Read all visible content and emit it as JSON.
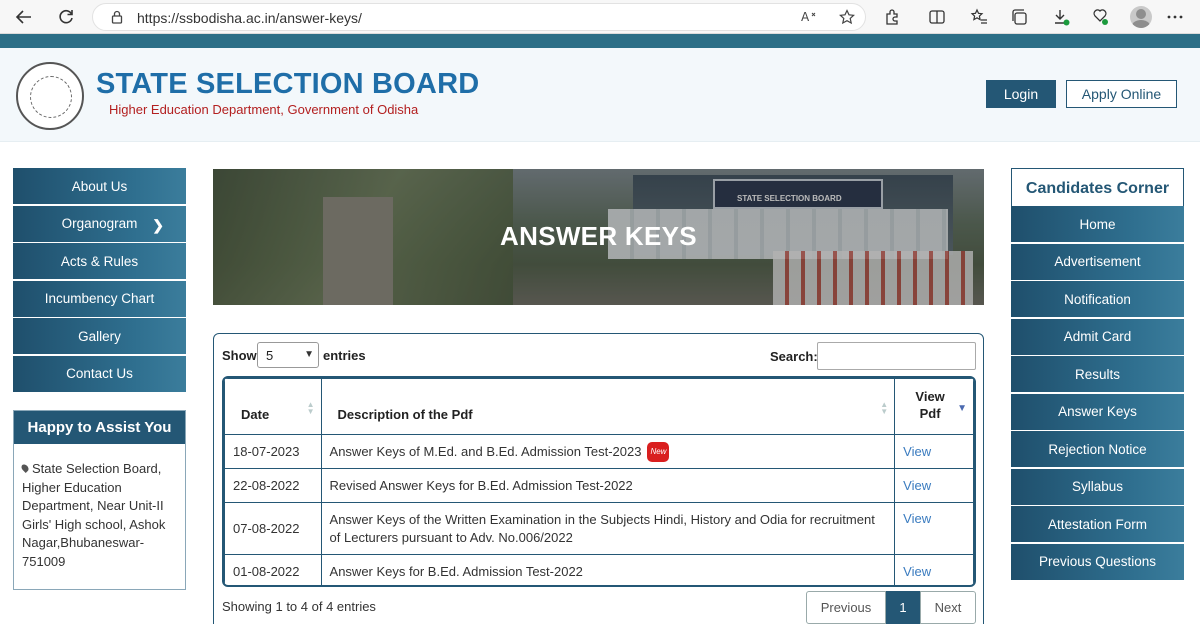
{
  "browser": {
    "url": "https://ssbodisha.ac.in/answer-keys/"
  },
  "header": {
    "title": "STATE SELECTION BOARD",
    "subtitle": "Higher Education Department, Government of Odisha",
    "login_label": "Login",
    "apply_label": "Apply Online"
  },
  "left_nav": {
    "items": [
      {
        "label": "About Us"
      },
      {
        "label": "Organogram",
        "has_submenu": true
      },
      {
        "label": "Acts & Rules"
      },
      {
        "label": "Incumbency Chart"
      },
      {
        "label": "Gallery"
      },
      {
        "label": "Contact Us"
      }
    ]
  },
  "assist": {
    "title": "Happy to Assist You",
    "address": "State Selection Board, Higher Education Department, Near Unit-II Girls' High school, Ashok Nagar,Bhubaneswar-751009"
  },
  "banner": {
    "title": "ANSWER KEYS",
    "sign_text": "STATE SELECTION BOARD"
  },
  "table": {
    "show_label": "Show",
    "entries_value": "5",
    "entries_label": "entries",
    "search_label": "Search:",
    "search_value": "",
    "columns": [
      "Date",
      "Description of the Pdf",
      "View Pdf"
    ],
    "rows": [
      {
        "date": "18-07-2023",
        "description": "Answer Keys of M.Ed. and B.Ed. Admission Test-2023",
        "badge": "New",
        "view": "View"
      },
      {
        "date": "22-08-2022",
        "description": "Revised Answer Keys for B.Ed. Admission Test-2022",
        "view": "View"
      },
      {
        "date": "07-08-2022",
        "description": "Answer Keys of the Written Examination in the Subjects Hindi, History and Odia for recruitment of Lecturers pursuant to Adv. No.006/2022",
        "view": "View"
      },
      {
        "date": "01-08-2022",
        "description": "Answer Keys for B.Ed. Admission Test-2022",
        "view": "View"
      }
    ],
    "info": "Showing 1 to 4 of 4 entries",
    "pager": {
      "previous": "Previous",
      "current": "1",
      "next": "Next"
    }
  },
  "right_nav": {
    "title": "Candidates Corner",
    "items": [
      {
        "label": "Home"
      },
      {
        "label": "Advertisement"
      },
      {
        "label": "Notification"
      },
      {
        "label": "Admit Card"
      },
      {
        "label": "Results"
      },
      {
        "label": "Answer Keys"
      },
      {
        "label": "Rejection Notice"
      },
      {
        "label": "Syllabus"
      },
      {
        "label": "Attestation Form"
      },
      {
        "label": "Previous Questions"
      }
    ]
  },
  "colors": {
    "brand_dark": "#245775",
    "brand_title": "#1f6ea8",
    "subtitle_red": "#b32020",
    "link_blue": "#3a7bbf"
  }
}
